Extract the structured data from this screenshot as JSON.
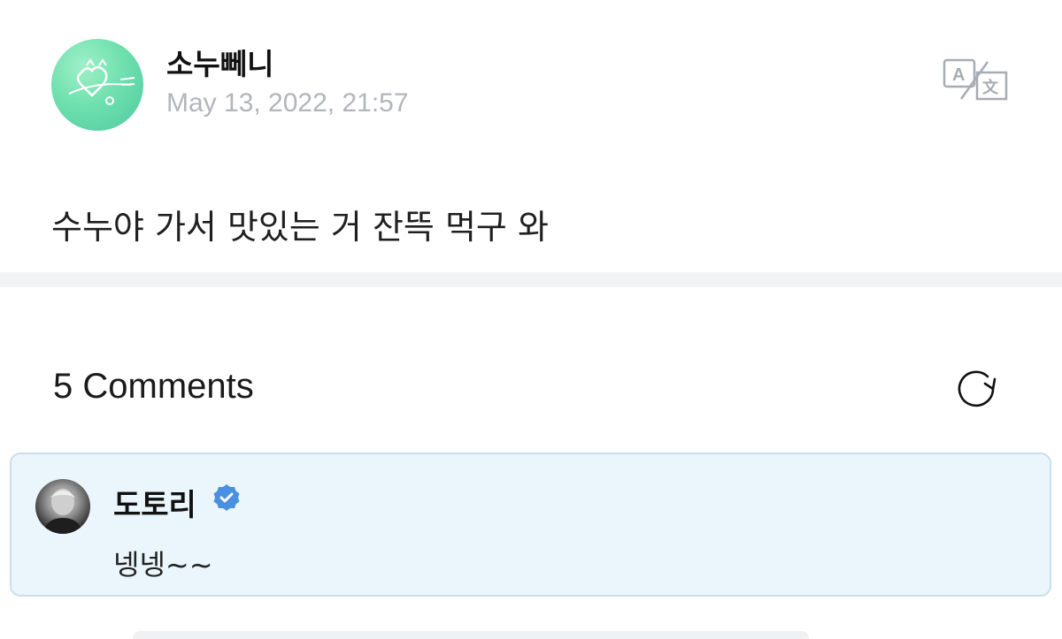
{
  "post": {
    "author": "소누뻬니",
    "date": "May 13, 2022, 21:57",
    "body": "수누야 가서 맛있는 거 잔뜩 먹구 와",
    "translate_icon": "translate-icon"
  },
  "comments": {
    "count_label": "5 Comments",
    "refresh_icon": "refresh-icon",
    "items": [
      {
        "author": "도토리",
        "verified": true,
        "text": "넹넹~~"
      }
    ]
  },
  "colors": {
    "avatar_green": "#6fe0ae",
    "verified_blue": "#4a90e2",
    "comment_bg": "#eaf6fc",
    "date_gray": "#b3b5bb"
  }
}
